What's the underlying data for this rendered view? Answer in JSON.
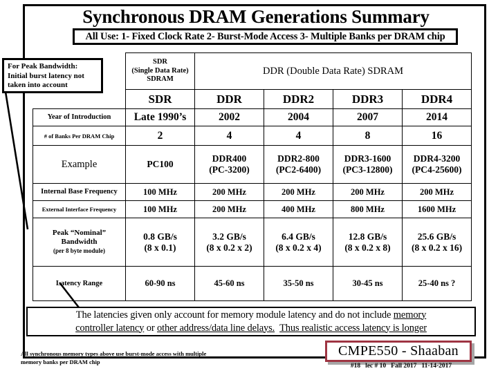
{
  "slide": {
    "title": "Synchronous DRAM Generations Summary",
    "all_use_note": "All Use:   1- Fixed  Clock Rate     2- Burst-Mode  Access  3- Multiple Banks per DRAM chip"
  },
  "callout": {
    "line1": "For Peak Bandwidth:",
    "line2": "Initial burst latency not",
    "line3": "taken into account"
  },
  "table": {
    "group_headers": {
      "sdr_l1": "SDR",
      "sdr_l2": "(Single Data Rate)",
      "sdr_l3": "SDRAM",
      "ddr": "DDR (Double Data Rate) SDRAM"
    },
    "columns": [
      "SDR",
      "DDR",
      "DDR2",
      "DDR3",
      "DDR4"
    ],
    "rows": [
      {
        "label": "Year of Introduction",
        "label_style": "small",
        "values": [
          "Late 1990’s",
          "2002",
          "2004",
          "2007",
          "2014"
        ]
      },
      {
        "label": "# of Banks Per DRAM Chip",
        "label_style": "tiny",
        "values": [
          "2",
          "4",
          "4",
          "8",
          "16"
        ]
      },
      {
        "label": "Example",
        "label_style": "med",
        "values_l1": [
          "PC100",
          "DDR400",
          "DDR2-800",
          "DDR3-1600",
          "DDR4-3200"
        ],
        "values_l2": [
          "",
          "(PC-3200)",
          "(PC2-6400)",
          "(PC3-12800)",
          "(PC4-25600)"
        ]
      },
      {
        "label": "Internal Base Frequency",
        "label_style": "small",
        "values": [
          "100 MHz",
          "200 MHz",
          "200 MHz",
          "200 MHz",
          "200 MHz"
        ]
      },
      {
        "label": "External Interface Frequency",
        "label_style": "tiny",
        "values": [
          "100 MHz",
          "200 MHz",
          "400 MHz",
          "800 MHz",
          "1600 MHz"
        ]
      },
      {
        "label_l1": "Peak  “Nominal”",
        "label_l2": "Bandwidth",
        "label_l3": "(per 8 byte module)",
        "label_style": "peak",
        "values_l1": [
          "0.8 GB/s",
          "3.2 GB/s",
          "6.4 GB/s",
          "12.8 GB/s",
          "25.6 GB/s"
        ],
        "values_l2": [
          "(8 x 0.1)",
          "(8 x 0.2 x 2)",
          "(8 x 0.2 x 4)",
          "(8 x 0.2 x 8)",
          "(8 x 0.2 x 16)"
        ]
      },
      {
        "label": "Latency Range",
        "label_style": "small",
        "values": [
          "60-90 ns",
          "45-60 ns",
          "35-50 ns",
          "30-45 ns",
          "25-40 ns ?"
        ]
      }
    ]
  },
  "note": {
    "line1_a": "The latencies given only account for memory module latency and do not include ",
    "line1_u": "memory",
    "line2_u1": "controller latency",
    "line2_a": " or ",
    "line2_u2": "other address/data line delays.",
    "line2_b": "  ",
    "line2_u3": "Thus realistic access latency is longer"
  },
  "bottom_note": {
    "line1": "All synchronous memory types  above use burst-mode access  with multiple",
    "line2": "memory banks per DRAM chip"
  },
  "course": {
    "badge": "CMPE550 - Shaaban",
    "slide_number": "#18",
    "lecture": "lec # 10",
    "term": "Fall 2017",
    "date": "11-14-2017"
  },
  "colors": {
    "badge_border": "#9e3442",
    "badge_shadow": "#a6a6a6",
    "ink": "#000000",
    "paper": "#ffffff"
  }
}
